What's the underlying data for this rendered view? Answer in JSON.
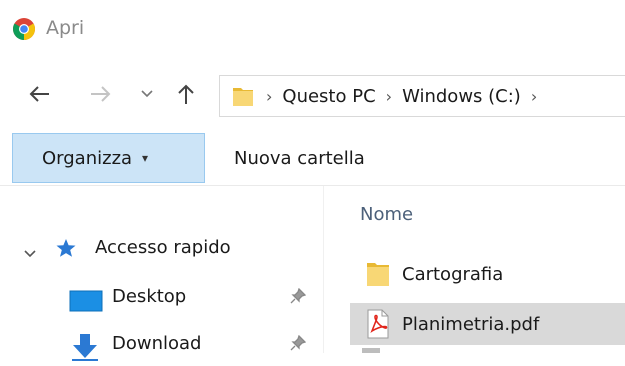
{
  "window": {
    "title": "Apri",
    "app_icon": "chrome-icon"
  },
  "nav": {
    "back_icon": "arrow-left-icon",
    "forward_icon": "arrow-right-icon",
    "recent_icon": "chevron-down-icon",
    "up_icon": "arrow-up-icon"
  },
  "address": {
    "segments": [
      "Questo PC",
      "Windows (C:)"
    ],
    "separator": "›"
  },
  "toolbar": {
    "organize_label": "Organizza",
    "organize_caret": "▾",
    "new_folder_label": "Nuova cartella"
  },
  "sidebar": {
    "quick_access": {
      "label": "Accesso rapido",
      "icon": "star-icon",
      "expanded": true
    },
    "items": [
      {
        "label": "Desktop",
        "icon": "desktop-icon",
        "pinned": true
      },
      {
        "label": "Download",
        "icon": "download-icon",
        "pinned": true
      }
    ]
  },
  "filelist": {
    "column_name": "Nome",
    "files": [
      {
        "name": "Cartografia",
        "type": "folder",
        "icon": "folder-icon",
        "selected": false
      },
      {
        "name": "Planimetria.pdf",
        "type": "pdf",
        "icon": "pdf-icon",
        "selected": true
      }
    ]
  },
  "colors": {
    "organize_bg": "#cce4f7",
    "organize_border": "#99c9ef",
    "selected_row": "#d9d9d9",
    "folder_yellow": "#f8d775",
    "header_text": "#4c607a",
    "quick_access_star": "#2b79d3"
  }
}
